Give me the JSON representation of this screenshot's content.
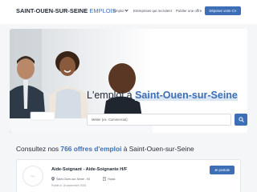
{
  "header": {
    "logo_main": "SAINT-OUEN-SUR-SEINE",
    "logo_accent": "EMPLOIS",
    "nav_emploi": "Emploi",
    "nav_recruit": "Entreprises qui recrutent",
    "nav_publish": "Publier une offre",
    "cv_button": "Déposez votre CV"
  },
  "hero": {
    "title_prefix": "L'emploi à",
    "title_city": "Saint-Ouen-sur-Seine",
    "search_placeholder": "Métier (ex. Commercial)"
  },
  "offers": {
    "title_prefix": "Consultez nos",
    "count": "766 offres d'emploi",
    "title_suffix": "à Saint-Ouen-sur-Seine"
  },
  "job": {
    "logo_text": "logo",
    "title": "Aide-Soignant - Aide-Soignante H/F",
    "location": "Saint-Ouen-sur-Seine - 93",
    "company": "Hopia",
    "date": "Publié le 16 septembre 2025",
    "apply_label": "Je postule"
  },
  "colors": {
    "accent": "#3d6fb6",
    "background": "#f5f6f8"
  }
}
